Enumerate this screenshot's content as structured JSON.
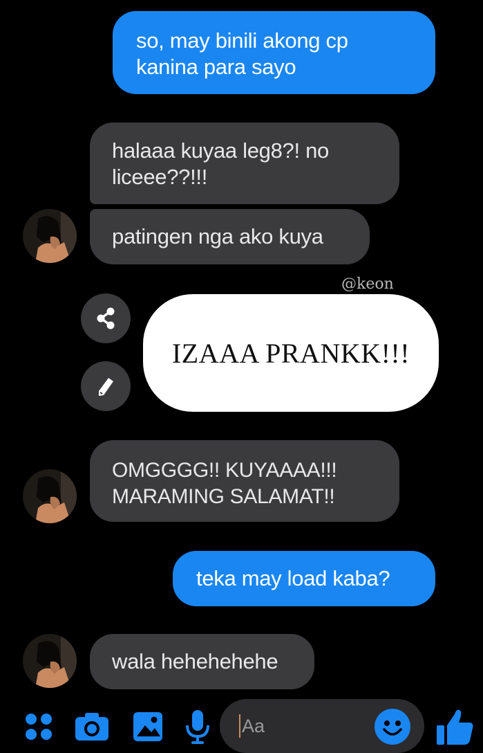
{
  "messages": [
    {
      "id": "b1",
      "direction": "sent",
      "text": "so, may binili akong cp kanina para sayo"
    },
    {
      "id": "b2",
      "direction": "received",
      "text": "halaaa kuyaa leg8?! no liceee??!!!"
    },
    {
      "id": "b3",
      "direction": "received",
      "text": "patingen nga ako kuya"
    },
    {
      "id": "b4",
      "direction": "received",
      "text": "OMGGGG!! KUYAAAA!!! MARAMING SALAMAT!!"
    },
    {
      "id": "b5",
      "direction": "sent",
      "text": "teka may load kaba?"
    },
    {
      "id": "b6",
      "direction": "received",
      "text": "wala hehehehehe"
    }
  ],
  "image_message": {
    "caption": "IZAAA PRANKK!!!",
    "watermark": "@keon"
  },
  "image_actions": {
    "share_icon": "share-icon",
    "edit_icon": "pencil-icon"
  },
  "composer": {
    "placeholder": "Aa",
    "icons": [
      "apps-icon",
      "camera-icon",
      "gallery-icon",
      "microphone-icon",
      "emoji-icon",
      "thumbs-up-icon"
    ]
  },
  "colors": {
    "background": "#000000",
    "sent_bubble": "#1a86f2",
    "received_bubble": "#3b3b3e",
    "accent": "#1a86f2"
  }
}
